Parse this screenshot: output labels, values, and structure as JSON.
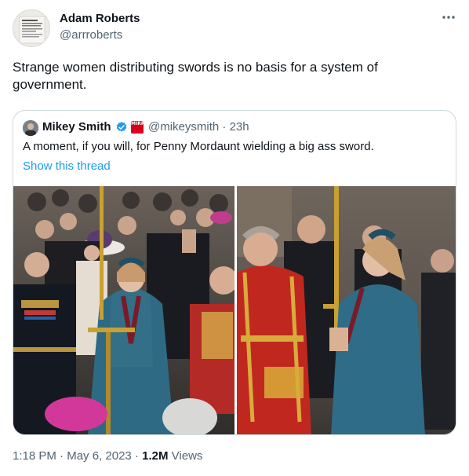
{
  "tweet": {
    "author": {
      "name": "Adam Roberts",
      "handle": "@arrroberts"
    },
    "text": "Strange women distributing swords is no basis for a system of government.",
    "more_icon": "more-dots-icon"
  },
  "quote": {
    "author": {
      "name": "Mikey Smith",
      "handle": "@mikeysmith",
      "separator": "·",
      "time": "23h"
    },
    "badges": [
      "verified-icon",
      "affiliate-badge-icon"
    ],
    "affiliate_badge_text": "MIRROR",
    "text": "A moment, if you will, for Penny Mordaunt wielding a big ass sword.",
    "show_thread": "Show this thread",
    "images": [
      "coronation-photo-left",
      "coronation-photo-right"
    ]
  },
  "meta": {
    "time": "1:18 PM",
    "separator": "·",
    "date": "May 6, 2023",
    "views_count": "1.2M",
    "views_label": "Views"
  },
  "colors": {
    "link": "#1d9bf0",
    "secondary": "#536471",
    "border": "#cfd9de",
    "text": "#0f1419"
  }
}
